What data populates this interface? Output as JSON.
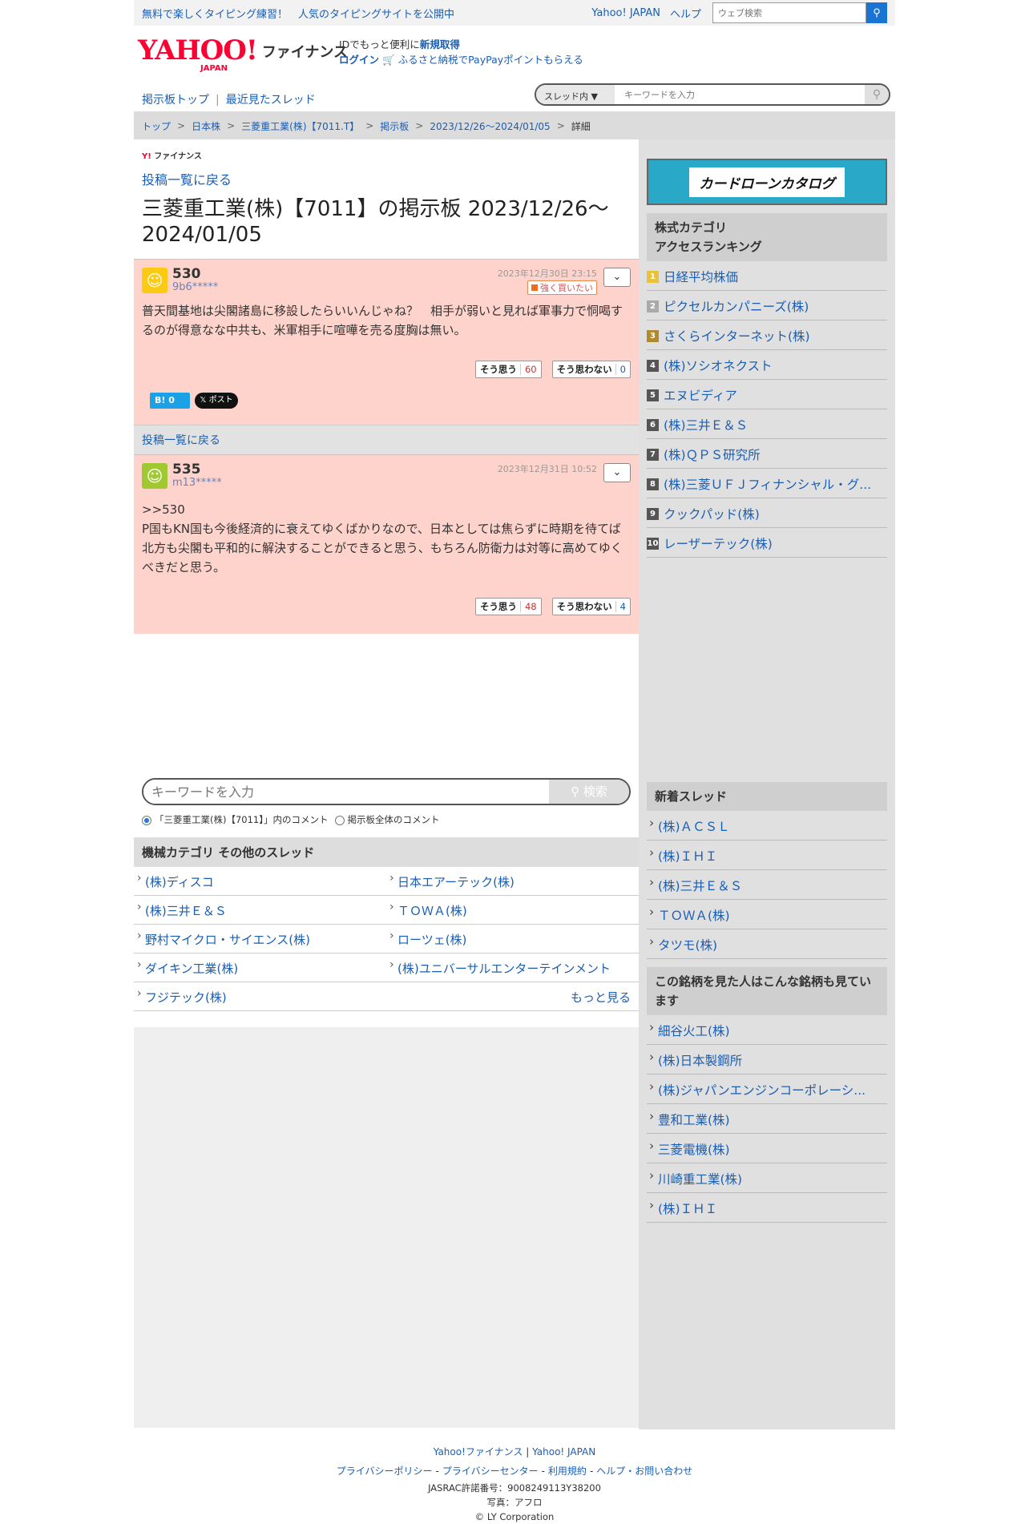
{
  "topbar": {
    "promo": "無料で楽しくタイピング練習！　人気のタイピングサイトを公開中",
    "yahoo_japan": "Yahoo! JAPAN",
    "help": "ヘルプ",
    "search_placeholder": "ウェブ検索"
  },
  "header": {
    "logo_text": "YAHOO!",
    "logo_sub": "JAPAN",
    "service": "ファイナンス",
    "id_line_prefix": "IDでもっと便利に",
    "id_signup": "新規取得",
    "login": "ログイン",
    "furusato": "ふるさと納税でPayPayポイントもらえる"
  },
  "nav": {
    "board_top": "掲示板トップ",
    "recent": "最近見たスレッド",
    "sep": "|"
  },
  "thread_search": {
    "scope": "スレッド内",
    "placeholder": "キーワードを入力"
  },
  "breadcrumb": [
    "トップ",
    "日本株",
    "三菱重工業(株)【7011.T】",
    "掲示板",
    "2023/12/26〜2024/01/05",
    "詳細"
  ],
  "main": {
    "mini_logo": "ファイナンス",
    "back": "投稿一覧に戻る",
    "title": "三菱重工業(株)【7011】の掲示板 2023/12/26〜2024/01/05",
    "posts": [
      {
        "num": "530",
        "user": "9b6*****",
        "date": "2023年12月30日 23:15",
        "sentiment": "強く買いたい",
        "text": "普天間基地は尖閣諸島に移設したらいいんじゃね？　相手が弱いと見れば軍事力で恫喝するのが得意なな中共も、米軍相手に喧嘩を売る度胸は無い。",
        "agree_label": "そう思う",
        "agree": "60",
        "disagree_label": "そう思わない",
        "disagree": "0",
        "hatena": "0",
        "x": "ポスト"
      },
      {
        "num": "535",
        "user": "m13*****",
        "date": "2023年12月31日 10:52",
        "text1": ">>530",
        "text2": "P国もKN国も今後経済的に衰えてゆくばかりなので、日本としては焦らずに時期を待てば北方も尖閣も平和的に解決することができると思う、もちろん防衛力は対等に高めてゆくべきだと思う。",
        "agree_label": "そう思う",
        "agree": "48",
        "disagree_label": "そう思わない",
        "disagree": "4"
      }
    ],
    "back2": "投稿一覧に戻る",
    "search_placeholder": "キーワードを入力",
    "search_button": "検索",
    "radio1": "「三菱重工業(株)【7011】」内のコメント",
    "radio2": "掲示板全体のコメント",
    "category_head": "機械カテゴリ  その他のスレッド",
    "category_items": [
      "(株)ディスコ",
      "日本エアーテック(株)",
      "(株)三井Ｅ＆Ｓ",
      "ＴＯＷＡ(株)",
      "野村マイクロ・サイエンス(株)",
      "ローツェ(株)",
      "ダイキン工業(株)",
      "(株)ユニバーサルエンターテインメント",
      "フジテック(株)"
    ],
    "more": "もっと見る"
  },
  "side": {
    "ad_text": "カードローンカタログ",
    "ranking_head_1": "株式カテゴリ",
    "ranking_head_2": "アクセスランキング",
    "ranking": [
      {
        "n": "1",
        "name": "日経平均株価"
      },
      {
        "n": "2",
        "name": "ピクセルカンパニーズ(株)"
      },
      {
        "n": "3",
        "name": "さくらインターネット(株)"
      },
      {
        "n": "4",
        "name": "(株)ソシオネクスト"
      },
      {
        "n": "5",
        "name": "エヌビディア"
      },
      {
        "n": "6",
        "name": "(株)三井Ｅ＆Ｓ"
      },
      {
        "n": "7",
        "name": "(株)ＱＰＳ研究所"
      },
      {
        "n": "8",
        "name": "(株)三菱ＵＦＪフィナンシャル・グ..."
      },
      {
        "n": "9",
        "name": "クックパッド(株)"
      },
      {
        "n": "10",
        "name": "レーザーテック(株)"
      }
    ],
    "new_head": "新着スレッド",
    "new_threads": [
      "(株)ＡＣＳＬ",
      "(株)ＩＨＩ",
      "(株)三井Ｅ＆Ｓ",
      "ＴＯＷＡ(株)",
      "タツモ(株)"
    ],
    "related_head": "この銘柄を見た人はこんな銘柄も見ています",
    "related": [
      "細谷火工(株)",
      "(株)日本製鋼所",
      "(株)ジャパンエンジンコーポレーシ...",
      "豊和工業(株)",
      "三菱電機(株)",
      "川崎重工業(株)",
      "(株)ＩＨＩ"
    ]
  },
  "footer": {
    "fin": "Yahoo!ファイナンス",
    "yj": "Yahoo! JAPAN",
    "privacy": "プライバシーポリシー",
    "privacy_center": "プライバシーセンター",
    "terms": "利用規約",
    "help": "ヘルプ・お問い合わせ",
    "jasrac": "JASRAC許諾番号：9008249113Y38200",
    "photo": "写真：アフロ",
    "copy": "© LY Corporation"
  }
}
